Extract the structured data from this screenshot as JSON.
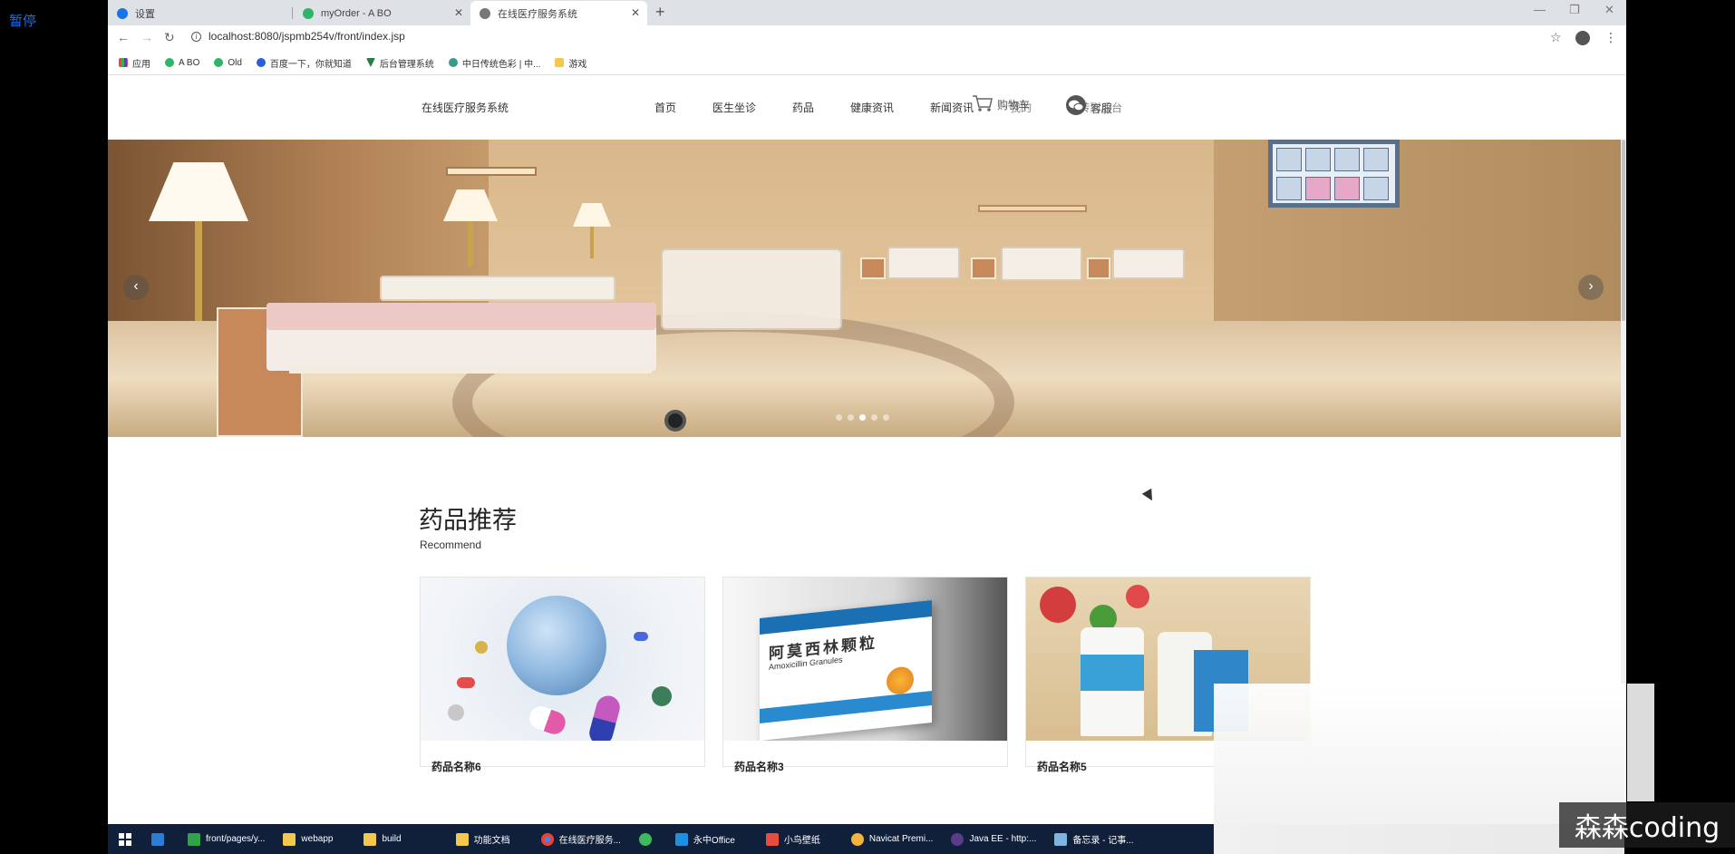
{
  "pause_label": "暂停",
  "tabs": [
    {
      "title": "设置",
      "icon": "gear-icon"
    },
    {
      "title": "myOrder - A BO",
      "icon": "yuque-icon"
    },
    {
      "title": "在线医疗服务系统",
      "icon": "globe-icon",
      "active": true
    }
  ],
  "address_bar": {
    "url": "localhost:8080/jspmb254v/front/index.jsp"
  },
  "bookmarks": [
    {
      "label": "应用",
      "icon": "apps-grid-icon"
    },
    {
      "label": "A BO",
      "icon": "yuque-icon"
    },
    {
      "label": "Old",
      "icon": "yuque-icon"
    },
    {
      "label": "百度一下，你就知道",
      "icon": "baidu-paw-icon"
    },
    {
      "label": "后台管理系统",
      "icon": "vue-logo-icon"
    },
    {
      "label": "中日传统色彩 | 中...",
      "icon": "gear-flower-icon"
    },
    {
      "label": "游戏",
      "icon": "folder-icon"
    }
  ],
  "site": {
    "brand": "在线医疗服务系统",
    "nav": [
      "首页",
      "医生坐诊",
      "药品",
      "健康资讯",
      "新闻资讯",
      "我的",
      "跳转到后台"
    ],
    "cart_label": "购物车",
    "service_label": "客服"
  },
  "carousel": {
    "dot_count": 5,
    "active_index": 2
  },
  "section": {
    "title": "药品推荐",
    "subtitle": "Recommend"
  },
  "products": [
    {
      "name": "药品名称6",
      "image": "globe-pills"
    },
    {
      "name": "药品名称3",
      "image": "amoxicillin-box"
    },
    {
      "name": "药品名称5",
      "image": "medicine-bottles"
    }
  ],
  "amoxicillin_box": {
    "cn": "阿莫西林颗粒",
    "en": "Amoxicillin Granules"
  },
  "taskbar": [
    {
      "label": "",
      "icon": "windows-start-icon"
    },
    {
      "label": "",
      "icon": "app-icon"
    },
    {
      "label": "front/pages/y...",
      "icon": "hbuilder-icon"
    },
    {
      "label": "webapp",
      "icon": "folder-icon"
    },
    {
      "label": "build",
      "icon": "folder-icon"
    },
    {
      "label": "功能文档",
      "icon": "folder-icon"
    },
    {
      "label": "在线医疗服务...",
      "icon": "chrome-icon"
    },
    {
      "label": "",
      "icon": "green-circle-icon"
    },
    {
      "label": "永中Office",
      "icon": "office-icon"
    },
    {
      "label": "小鸟壁纸",
      "icon": "bird-icon"
    },
    {
      "label": "Navicat Premi...",
      "icon": "navicat-icon"
    },
    {
      "label": "Java EE - http:...",
      "icon": "eclipse-icon"
    },
    {
      "label": "备忘录 - 记事...",
      "icon": "notepad-icon"
    }
  ],
  "watermark": "森森coding",
  "colors": {
    "link_blue": "#1e6fe0",
    "taskbar_bg": "#101f3a",
    "tabstrip_bg": "#dee1e6"
  }
}
